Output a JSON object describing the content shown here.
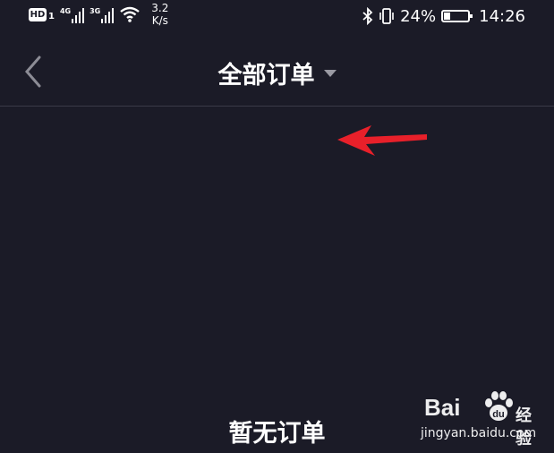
{
  "status_bar": {
    "hd_label": "HD",
    "sim_number": "1",
    "network_1": "4G",
    "network_2": "3G",
    "speed_value": "3.2",
    "speed_unit": "K/s",
    "battery_percent": "24%",
    "battery_level": 0.24,
    "time": "14:26"
  },
  "header": {
    "back_icon": "chevron-left-icon",
    "title": "全部订单",
    "dropdown_icon": "caret-down-icon"
  },
  "annotation": {
    "icon": "red-arrow-icon",
    "color": "#e8202a"
  },
  "empty_state": {
    "text": "暂无订单"
  },
  "watermark": {
    "logo_text": "Bai",
    "logo_suffix": "经验",
    "url": "jingyan.baidu.com"
  }
}
